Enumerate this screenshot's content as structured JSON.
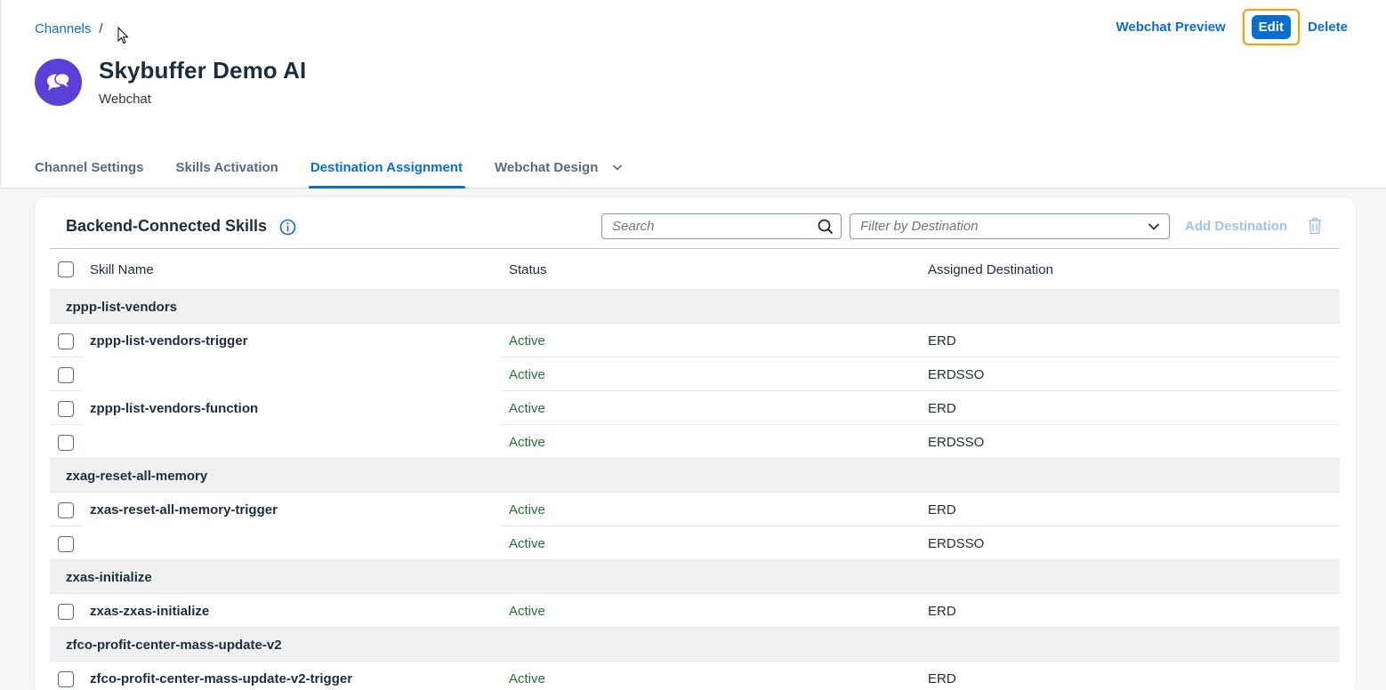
{
  "breadcrumb": {
    "root": "Channels",
    "separator": "/"
  },
  "header": {
    "title": "Skybuffer Demo AI",
    "subtitle": "Webchat",
    "avatar_icon": "chat-bubbles-icon",
    "avatar_color": "#5b3fd6"
  },
  "actions": {
    "preview": "Webchat Preview",
    "edit": "Edit",
    "delete": "Delete"
  },
  "tabs": [
    {
      "label": "Channel Settings"
    },
    {
      "label": "Skills Activation"
    },
    {
      "label": "Destination Assignment",
      "active": true
    },
    {
      "label": "Webchat Design"
    }
  ],
  "toolbar": {
    "title": "Backend-Connected Skills",
    "search_placeholder": "Search",
    "filter_placeholder": "Filter by Destination",
    "add_destination": "Add Destination"
  },
  "table": {
    "columns": {
      "skill": "Skill Name",
      "status": "Status",
      "destination": "Assigned Destination"
    },
    "groups": [
      {
        "name": "zppp-list-vendors"
      },
      {
        "name": "zxag-reset-all-memory"
      },
      {
        "name": "zxas-initialize"
      },
      {
        "name": "zfco-profit-center-mass-update-v2"
      }
    ],
    "rows": [
      {
        "skill": "zppp-list-vendors-trigger",
        "status": "Active",
        "destination": "ERD"
      },
      {
        "skill": "",
        "status": "Active",
        "destination": "ERDSSO"
      },
      {
        "skill": "zppp-list-vendors-function",
        "status": "Active",
        "destination": "ERD"
      },
      {
        "skill": "",
        "status": "Active",
        "destination": "ERDSSO"
      },
      {
        "skill": "zxas-reset-all-memory-trigger",
        "status": "Active",
        "destination": "ERD"
      },
      {
        "skill": "",
        "status": "Active",
        "destination": "ERDSSO"
      },
      {
        "skill": "zxas-zxas-initialize",
        "status": "Active",
        "destination": "ERD"
      },
      {
        "skill": "zfco-profit-center-mass-update-v2-trigger",
        "status": "Active",
        "destination": "ERD"
      }
    ]
  },
  "colors": {
    "accent": "#0a6ed1",
    "status_active": "#256f3a",
    "focus_outline": "#e8a317"
  }
}
